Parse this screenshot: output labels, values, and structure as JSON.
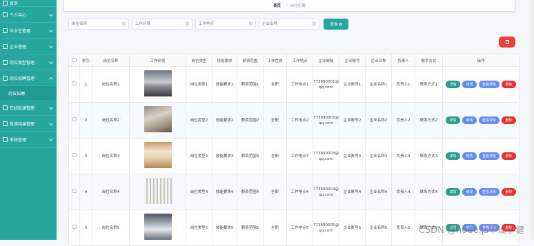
{
  "sidebar": {
    "items": [
      {
        "label": "首页",
        "chev": false
      },
      {
        "label": "个人中心",
        "chev": true
      },
      {
        "label": "毕业生管理",
        "chev": true
      },
      {
        "label": "企业管理",
        "chev": true
      },
      {
        "label": "岗位类型管理",
        "chev": true
      },
      {
        "label": "岗位招聘管理",
        "chev": true
      }
    ],
    "sub_item": "岗位招聘",
    "items_after": [
      {
        "label": "在线投递管理",
        "chev": true
      },
      {
        "label": "投递结果管理",
        "chev": true
      },
      {
        "label": "系统管理",
        "chev": true
      }
    ]
  },
  "breadcrumb": {
    "home": "首页",
    "current": "岗位招聘"
  },
  "search": {
    "fields": [
      {
        "placeholder": "岗位名称"
      },
      {
        "placeholder": "工作环境"
      },
      {
        "placeholder": "工作地点"
      },
      {
        "placeholder": "企业名称"
      }
    ],
    "query_label": "查询"
  },
  "table": {
    "headers": [
      "",
      "索引",
      "岗位名称",
      "工作环境",
      "岗位类型",
      "技能要求",
      "薪资范围",
      "工作性质",
      "工作地点",
      "企业邮箱",
      "企业账号",
      "企业名称",
      "负责人",
      "联系方式",
      "操作"
    ],
    "rows": [
      {
        "index": "1",
        "name": "岗位名称1",
        "type": "岗位类型1",
        "skill": "技能要求1",
        "salary": "薪资范围1",
        "nature": "全职",
        "place": "工作地点1",
        "email": "773890001@qq.com",
        "account": "企业账号1",
        "company": "企业名称1",
        "manager": "负责人1",
        "contact": "联系方式1"
      },
      {
        "index": "2",
        "name": "岗位名称2",
        "type": "岗位类型2",
        "skill": "技能要求2",
        "salary": "薪资范围2",
        "nature": "全职",
        "place": "工作地点2",
        "email": "773890002@qq.com",
        "account": "企业账号2",
        "company": "企业名称2",
        "manager": "负责人2",
        "contact": "联系方式2"
      },
      {
        "index": "3",
        "name": "岗位名称3",
        "type": "岗位类型3",
        "skill": "技能要求3",
        "salary": "薪资范围3",
        "nature": "全职",
        "place": "工作地点3",
        "email": "773890003@qq.com",
        "account": "企业账号3",
        "company": "企业名称3",
        "manager": "负责人3",
        "contact": "联系方式3"
      },
      {
        "index": "4",
        "name": "岗位名称4",
        "type": "岗位类型4",
        "skill": "技能要求4",
        "salary": "薪资范围4",
        "nature": "全职",
        "place": "工作地点4",
        "email": "773890004@qq.com",
        "account": "企业账号4",
        "company": "企业名称4",
        "manager": "负责人4",
        "contact": "联系方式4"
      },
      {
        "index": "5",
        "name": "岗位名称5",
        "type": "岗位类型5",
        "skill": "技能要求5",
        "salary": "薪资范围5",
        "nature": "全职",
        "place": "工作地点5",
        "email": "773890005@qq.com",
        "account": "企业账号5",
        "company": "企业名称5",
        "manager": "负责人5",
        "contact": "联系方式5"
      }
    ],
    "ops": {
      "detail": "详情",
      "edit": "修改",
      "review": "查看评论",
      "delete": "删除"
    }
  },
  "watermark": "CSDN @node.js毕设小健",
  "colors": {
    "sidebar": "#25a7a0",
    "query": "#25a7a0",
    "delete": "#e93f38",
    "detail": "#2a9d8f",
    "edit": "#5b8def",
    "review": "#6b8bf5",
    "row_delete": "#f22c2c"
  },
  "icons": {
    "search": "search-icon",
    "trash": "trash-icon",
    "menu": "menu-icon",
    "chevron": "chevron-down-icon"
  }
}
